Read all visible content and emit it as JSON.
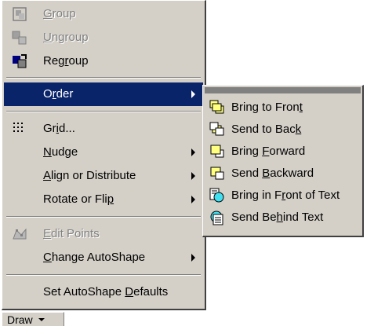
{
  "menu": {
    "group": {
      "pre": "",
      "key": "G",
      "post": "roup"
    },
    "ungroup": {
      "pre": "",
      "key": "U",
      "post": "ngroup"
    },
    "regroup": {
      "pre": "Reg",
      "key": "r",
      "post": "oup"
    },
    "order": {
      "pre": "O",
      "key": "r",
      "post": "der"
    },
    "grid": {
      "pre": "Gr",
      "key": "i",
      "post": "d..."
    },
    "nudge": {
      "pre": "",
      "key": "N",
      "post": "udge"
    },
    "align": {
      "pre": "",
      "key": "A",
      "post": "lign or Distribute"
    },
    "rotate": {
      "pre": "Rotate or Fli",
      "key": "p",
      "post": ""
    },
    "edit_points": {
      "pre": "",
      "key": "E",
      "post": "dit Points"
    },
    "change_autoshape": {
      "pre": "",
      "key": "C",
      "post": "hange AutoShape"
    },
    "set_defaults": {
      "pre": "Set AutoShape ",
      "key": "D",
      "post": "efaults"
    }
  },
  "submenu": {
    "bring_to_front": {
      "pre": "Bring to Fron",
      "key": "t",
      "post": ""
    },
    "send_to_back": {
      "pre": "Send to Bac",
      "key": "k",
      "post": ""
    },
    "bring_forward": {
      "pre": "Bring ",
      "key": "F",
      "post": "orward"
    },
    "send_backward": {
      "pre": "Send ",
      "key": "B",
      "post": "ackward"
    },
    "bring_front_text": {
      "pre": "Bring in F",
      "key": "r",
      "post": "ont of Text"
    },
    "send_behind_text": {
      "pre": "Send Be",
      "key": "h",
      "post": "ind Text"
    }
  },
  "toolbar": {
    "draw_label": "Draw"
  },
  "colors": {
    "menu_face": "#d4d0c8",
    "selection": "#0a246a",
    "disabled_text": "#808080",
    "shape_yellow": "#ffff80",
    "shape_cyan": "#40e0f0"
  }
}
